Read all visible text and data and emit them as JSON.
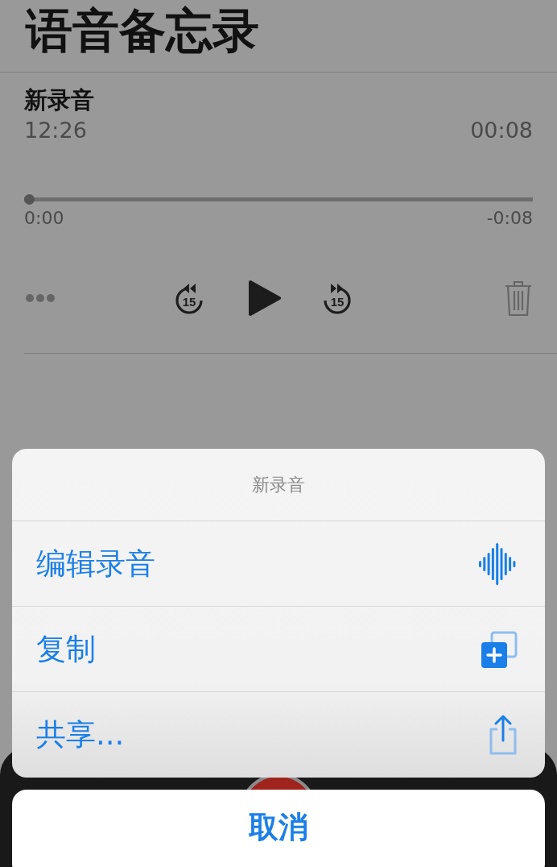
{
  "header": {
    "title": "语音备忘录"
  },
  "recording": {
    "name": "新录音",
    "date": "12:26",
    "duration": "00:08"
  },
  "scrubber": {
    "level": 0,
    "elapsed": "0:00",
    "remaining": "-0:08"
  },
  "controls": {
    "skip_back": "15",
    "skip_forward": "15"
  },
  "action_sheet": {
    "title": "新录音",
    "actions": [
      {
        "label": "编辑录音",
        "kind": "waveform"
      },
      {
        "label": "复制",
        "kind": "duplicate"
      },
      {
        "label": "共享...",
        "kind": "share"
      }
    ],
    "cancel": "取消"
  }
}
